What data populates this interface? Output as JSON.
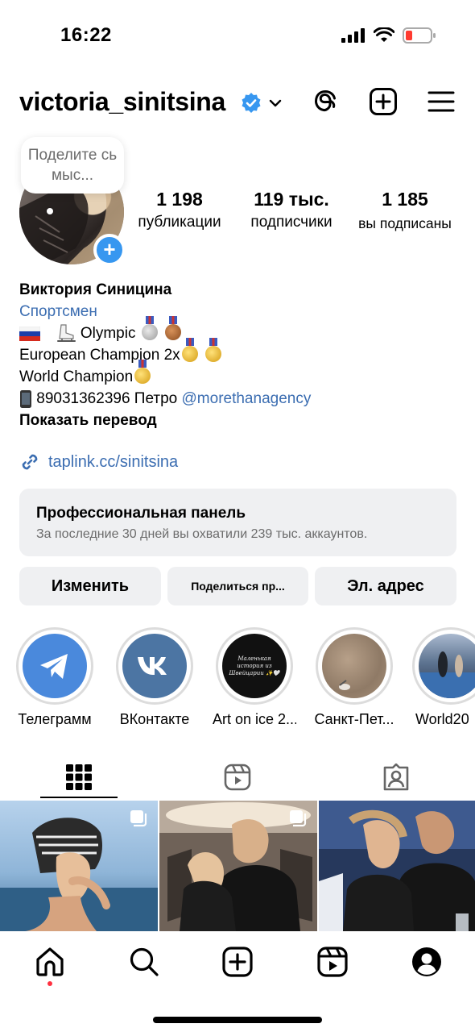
{
  "status_bar": {
    "time": "16:22"
  },
  "header": {
    "username": "victoria_sinitsina"
  },
  "note": {
    "text": "Поделите сь мыс..."
  },
  "stats": [
    {
      "value": "1 198",
      "label": "публикации"
    },
    {
      "value": "119 тыс.",
      "label": "подписчики"
    },
    {
      "value": "1 185",
      "label": "вы подписаны"
    }
  ],
  "bio": {
    "name": "Виктория Синицина",
    "category": "Спортсмен",
    "line1": "Olympic",
    "line2": "European Champion 2x",
    "line3": "World Champion",
    "line4_phone": "89031362396 Петро",
    "line4_mention": "@morethanagency",
    "translate": "Показать перевод"
  },
  "link": {
    "text": "taplink.cc/sinitsina"
  },
  "pro_panel": {
    "title": "Профессиональная панель",
    "subtitle": "За последние 30 дней вы охватили 239 тыс. аккаунтов."
  },
  "buttons": {
    "edit": "Изменить",
    "share": "Поделиться пр...",
    "email": "Эл. адрес"
  },
  "highlights": [
    {
      "label": "Телеграмм"
    },
    {
      "label": "ВКонтакте"
    },
    {
      "label": "Art on ice 2...",
      "cover_text": "Маленькая история из Швейцарии ✨🤍"
    },
    {
      "label": "Санкт-Пет..."
    },
    {
      "label": "World20"
    }
  ],
  "colors": {
    "accent_blue": "#3797f0",
    "link_blue": "#3b6db1",
    "panel_bg": "#eff0f2",
    "telegram": "#4a89dc",
    "vk": "#4c75a3",
    "notification_dot": "#ff3040"
  },
  "icons": {
    "header": [
      "threads-icon",
      "create-plus-icon",
      "menu-icon"
    ],
    "tabs": [
      "grid-icon",
      "reels-icon",
      "tagged-icon"
    ],
    "nav": [
      "home-icon",
      "search-icon",
      "create-icon",
      "reels-icon",
      "profile-icon"
    ]
  }
}
